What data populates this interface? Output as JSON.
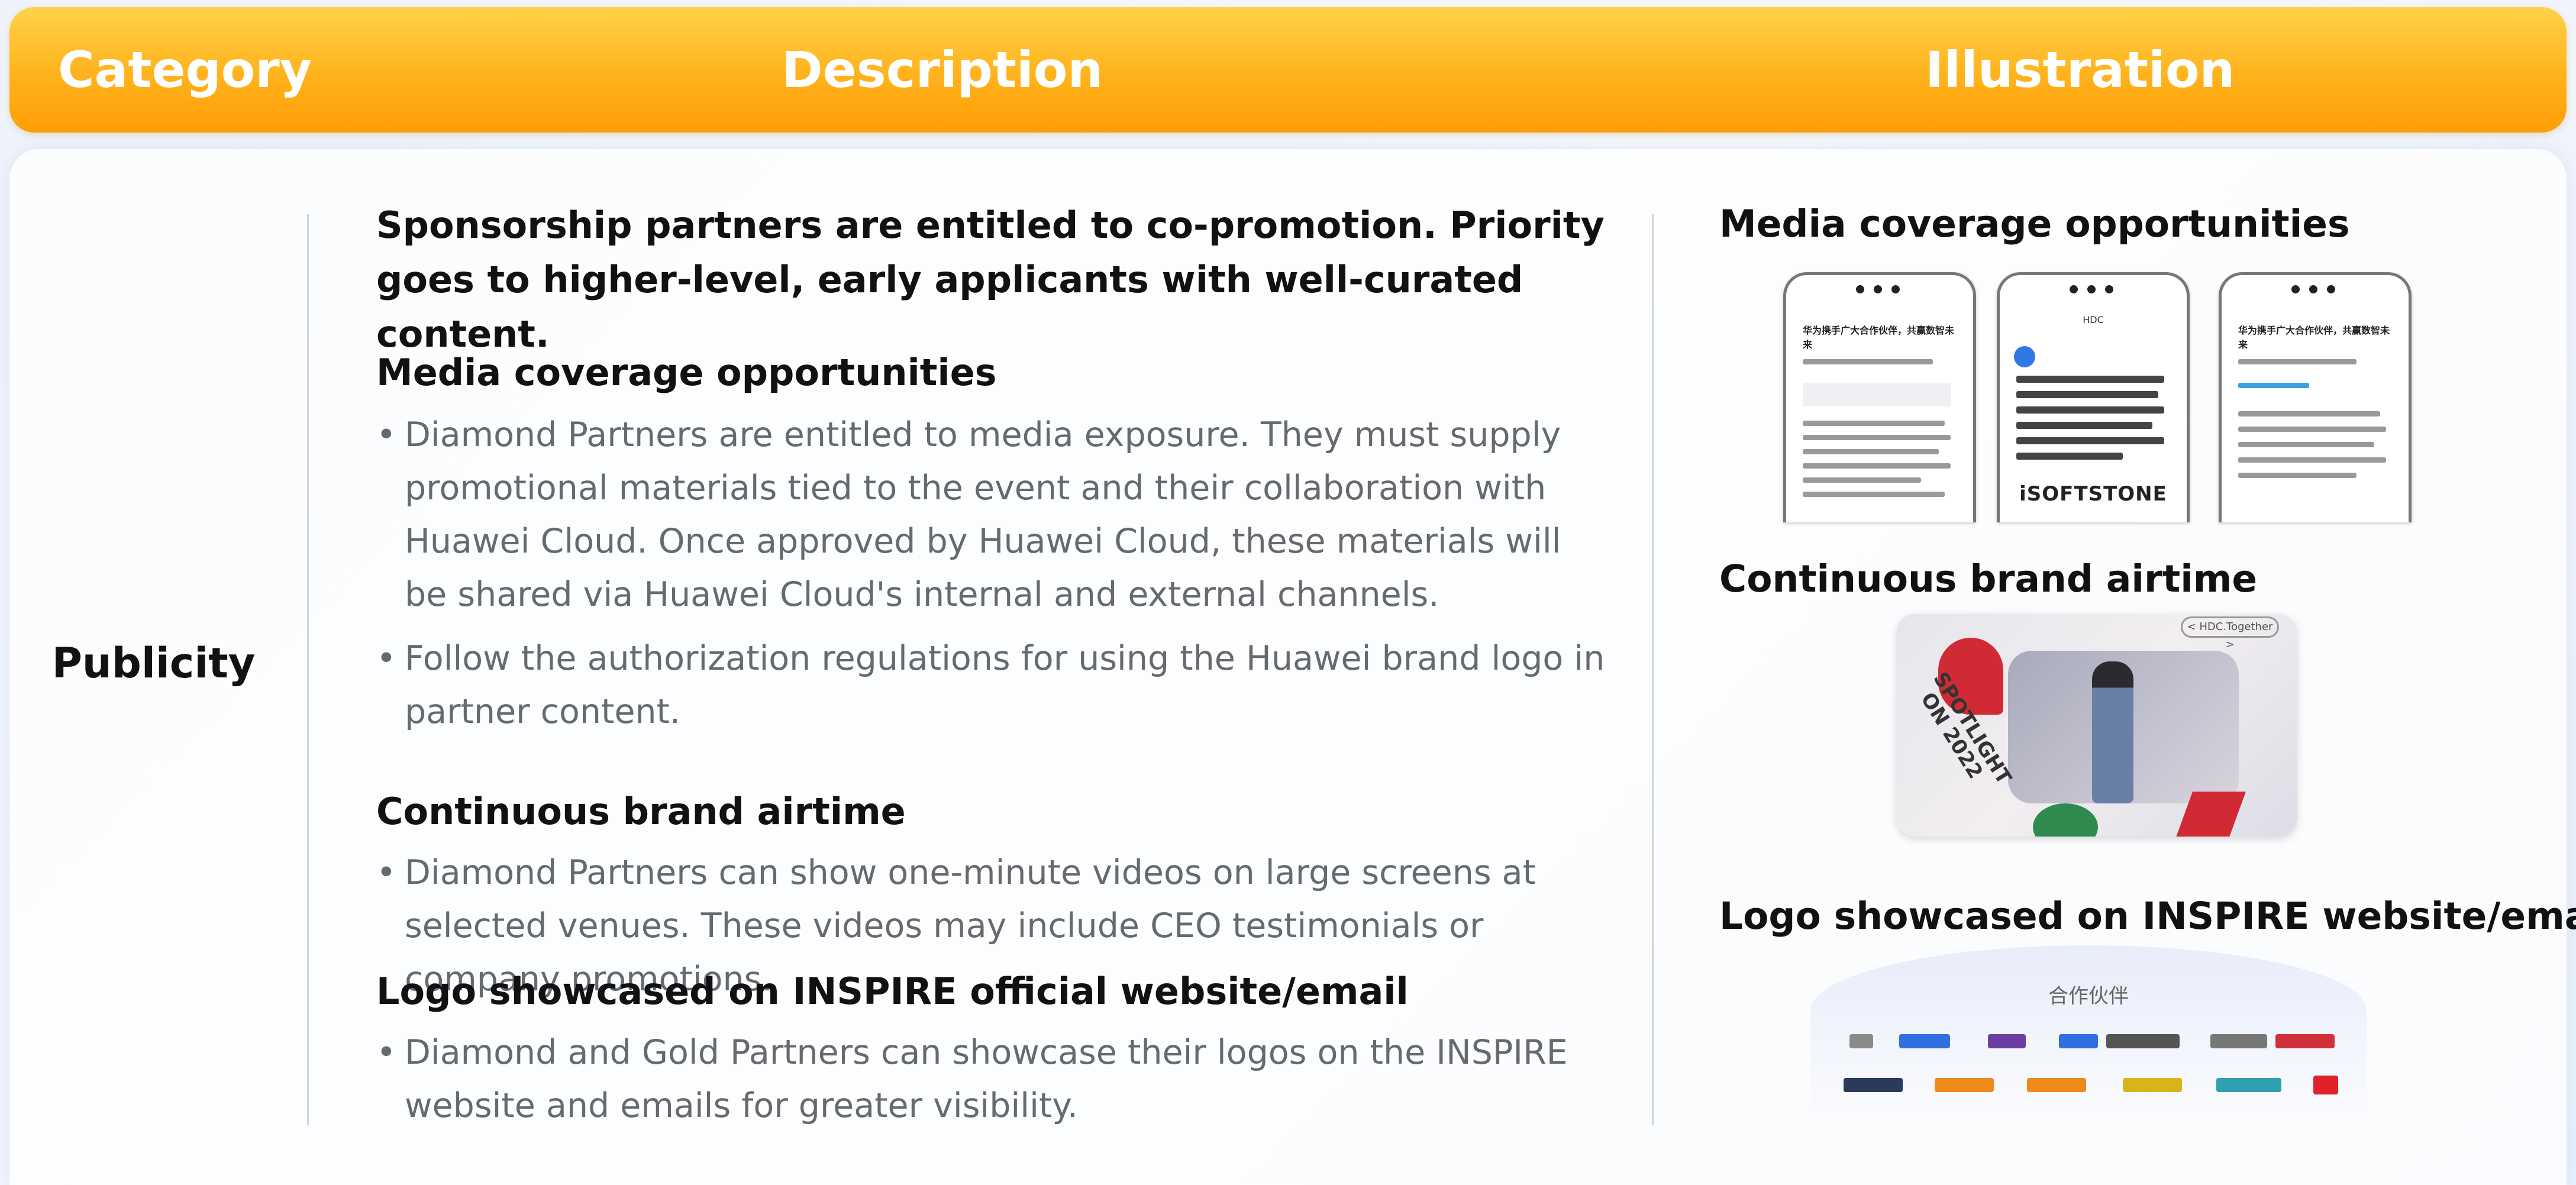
{
  "header": {
    "category_label": "Category",
    "description_label": "Description",
    "illustration_label": "Illustration"
  },
  "row": {
    "category": "Publicity",
    "lead": "Sponsorship partners are entitled to co-promotion. Priority goes to higher-level, early applicants with well-curated content.",
    "sections": [
      {
        "title": "Media coverage opportunities",
        "bullets": [
          "Diamond Partners are entitled to media exposure. They must supply promotional materials tied to the event and their collaboration with Huawei Cloud. Once approved by Huawei Cloud, these materials will be shared via Huawei Cloud's internal and external channels.",
          "Follow the authorization regulations for using the Huawei brand logo in partner content."
        ]
      },
      {
        "title": "Continuous brand airtime",
        "bullets": [
          "Diamond Partners can show one-minute videos on large screens at selected venues. These videos may include CEO testimonials or company promotions."
        ]
      },
      {
        "title": "Logo showcased on INSPIRE official website/email",
        "bullets": [
          "Diamond and Gold Partners can showcase their logos on the INSPIRE website and emails for greater visibility."
        ]
      }
    ]
  },
  "illustration": {
    "media_title": "Media coverage opportunities",
    "airtime_title": "Continuous brand airtime",
    "logo_title": "Logo showcased on INSPIRE website/email",
    "phone_headline": "华为携手广大合作伙伴，共赢数智未来",
    "phone_hdc": "HDC",
    "phone_brand": "iSOFTSTONE",
    "video_text": "SPOTLIGHT ON 2022",
    "video_tag": "< HDC.Together >",
    "partners_label": "合作伙伴"
  }
}
